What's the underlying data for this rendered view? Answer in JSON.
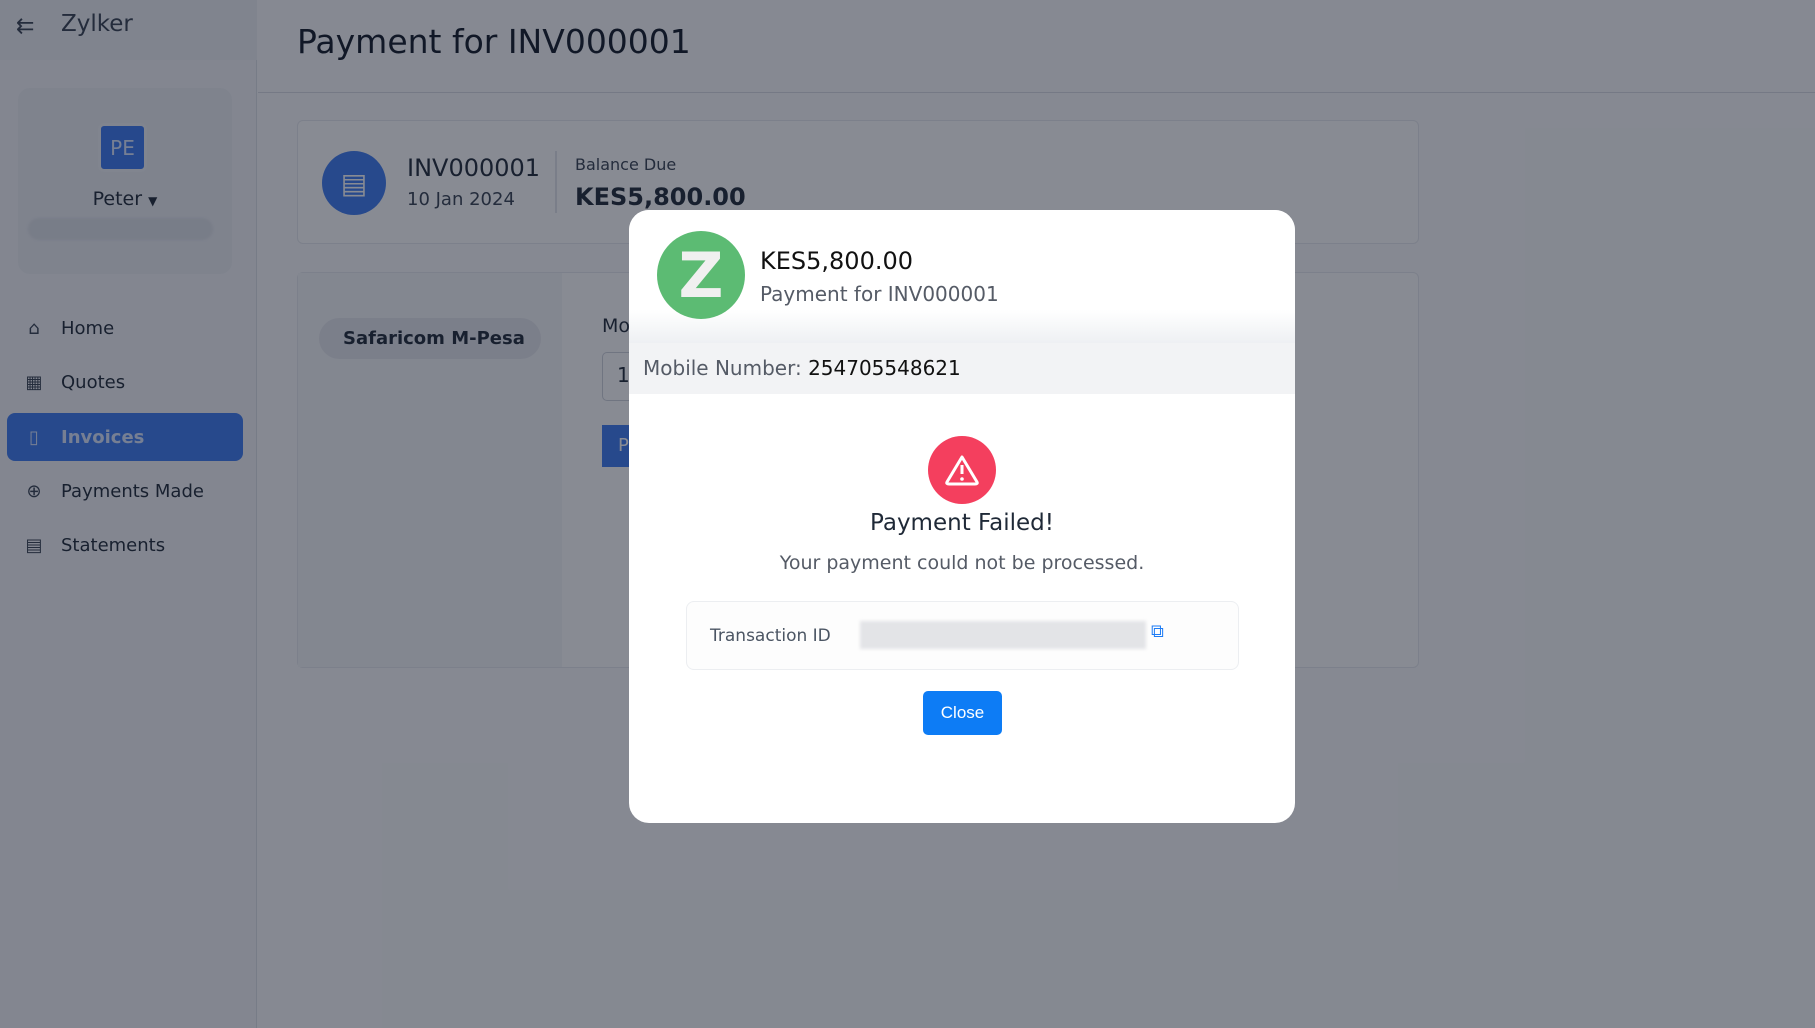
{
  "app": {
    "brand": "Zylker"
  },
  "user": {
    "initials": "PE",
    "name": "Peter"
  },
  "sidebar": {
    "items": [
      {
        "label": "Home",
        "icon": "home-icon"
      },
      {
        "label": "Quotes",
        "icon": "calculator-icon"
      },
      {
        "label": "Invoices",
        "icon": "document-icon",
        "active": true
      },
      {
        "label": "Payments Made",
        "icon": "upload-circle-icon"
      },
      {
        "label": "Statements",
        "icon": "statement-icon"
      }
    ]
  },
  "page": {
    "title": "Payment for INV000001"
  },
  "invoice": {
    "number": "INV000001",
    "date": "10 Jan 2024",
    "balance_label": "Balance Due",
    "balance": "KES5,800.00"
  },
  "payment_form": {
    "method": "Safaricom M-Pesa",
    "mobile_label": "Mo",
    "mobile_value": "1",
    "pay_button": "P"
  },
  "modal": {
    "amount": "KES5,800.00",
    "subtitle": "Payment for INV000001",
    "logo_letter": "Z",
    "mobile_label": "Mobile Number:",
    "mobile_number": "254705548621",
    "status_title": "Payment Failed!",
    "status_message": "Your payment could not be processed.",
    "transaction_label": "Transaction ID",
    "close_label": "Close",
    "colors": {
      "error": "#f43f5e",
      "primary": "#0d7cf5",
      "logo": "#5cbb73"
    }
  }
}
